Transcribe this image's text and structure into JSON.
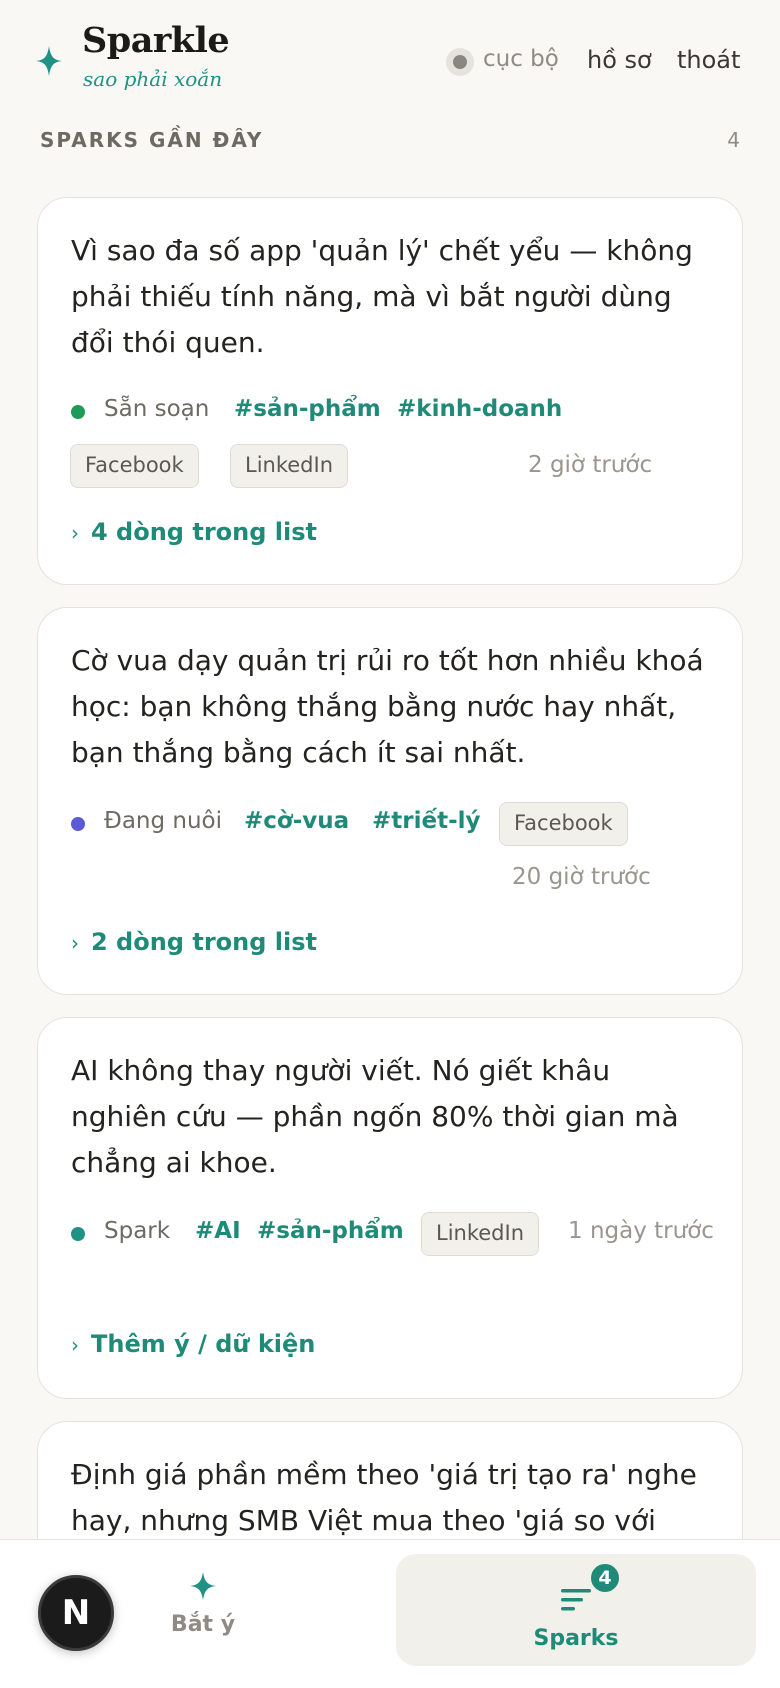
{
  "header": {
    "brand": "Sparkle",
    "tagline": "sao phải xoắn",
    "local_label": "cục bộ",
    "profile": "hồ sơ",
    "logout": "thoát"
  },
  "section": {
    "title": "SPARKS GẦN ĐÂY",
    "count": "4"
  },
  "cards": [
    {
      "text": "Vì sao đa số app 'quản lý' chết yểu — không phải thiếu tính năng, mà vì bắt người dùng đổi thói quen.",
      "status": "Sẵn soạn",
      "status_color": "#1f9a58",
      "tags": [
        "#sản-phẩm",
        "#kinh-doanh"
      ],
      "channels": [
        "Facebook",
        "LinkedIn"
      ],
      "time": "2 giờ trước",
      "expand": "4 dòng trong list"
    },
    {
      "text": "Cờ vua dạy quản trị rủi ro tốt hơn nhiều khoá học: bạn không thắng bằng nước hay nhất, bạn thắng bằng cách ít sai nhất.",
      "status": "Đang nuôi",
      "status_color": "#5b5bd6",
      "tags": [
        "#cờ-vua",
        "#triết-lý"
      ],
      "channels": [
        "Facebook"
      ],
      "time": "20 giờ trước",
      "expand": "2 dòng trong list"
    },
    {
      "text": "AI không thay người viết. Nó giết khâu nghiên cứu — phần ngốn 80% thời gian mà chẳng ai khoe.",
      "status": "Spark",
      "status_color": "#1f9285",
      "tags": [
        "#AI",
        "#sản-phẩm"
      ],
      "channels": [
        "LinkedIn"
      ],
      "time": "1 ngày trước",
      "expand": "Thêm ý / dữ kiện"
    },
    {
      "text": "Định giá phần mềm theo 'giá trị tạo ra' nghe hay, nhưng SMB Việt mua theo 'giá so với"
    }
  ],
  "tabbar": {
    "avatar_letter": "N",
    "capture_label": "Bắt ý",
    "sparks_label": "Sparks",
    "sparks_badge": "4"
  },
  "colors": {
    "accent": "#1f8a78",
    "background": "#f9f8f4"
  },
  "icons": {
    "logo": "sparkle-star-icon",
    "capture": "sparkle-star-icon",
    "sparks": "list-lines-icon",
    "expand": "chevron-right-icon"
  }
}
